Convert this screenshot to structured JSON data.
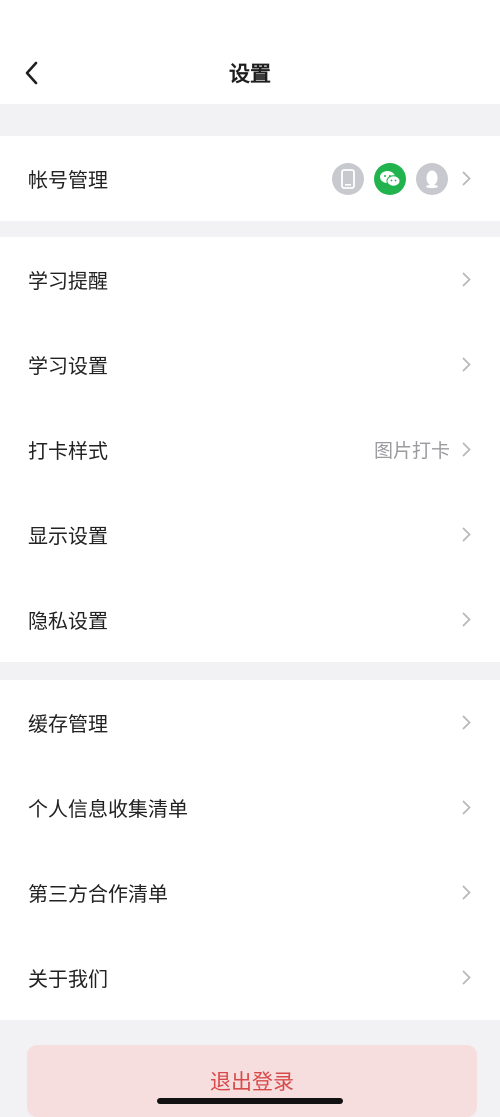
{
  "header": {
    "title": "设置"
  },
  "account": {
    "label": "帐号管理",
    "icons": [
      "phone-icon",
      "wechat-icon",
      "qq-icon"
    ],
    "colors": {
      "grey": "#c8c9ce",
      "wechat_green": "#21b34d"
    }
  },
  "study": {
    "items": [
      {
        "label": "学习提醒",
        "value": ""
      },
      {
        "label": "学习设置",
        "value": ""
      },
      {
        "label": "打卡样式",
        "value": "图片打卡"
      },
      {
        "label": "显示设置",
        "value": ""
      },
      {
        "label": "隐私设置",
        "value": ""
      }
    ]
  },
  "other": {
    "items": [
      {
        "label": "缓存管理"
      },
      {
        "label": "个人信息收集清单"
      },
      {
        "label": "第三方合作清单"
      },
      {
        "label": "关于我们"
      }
    ]
  },
  "logout": {
    "label": "退出登录",
    "color": "#d84a4a"
  }
}
